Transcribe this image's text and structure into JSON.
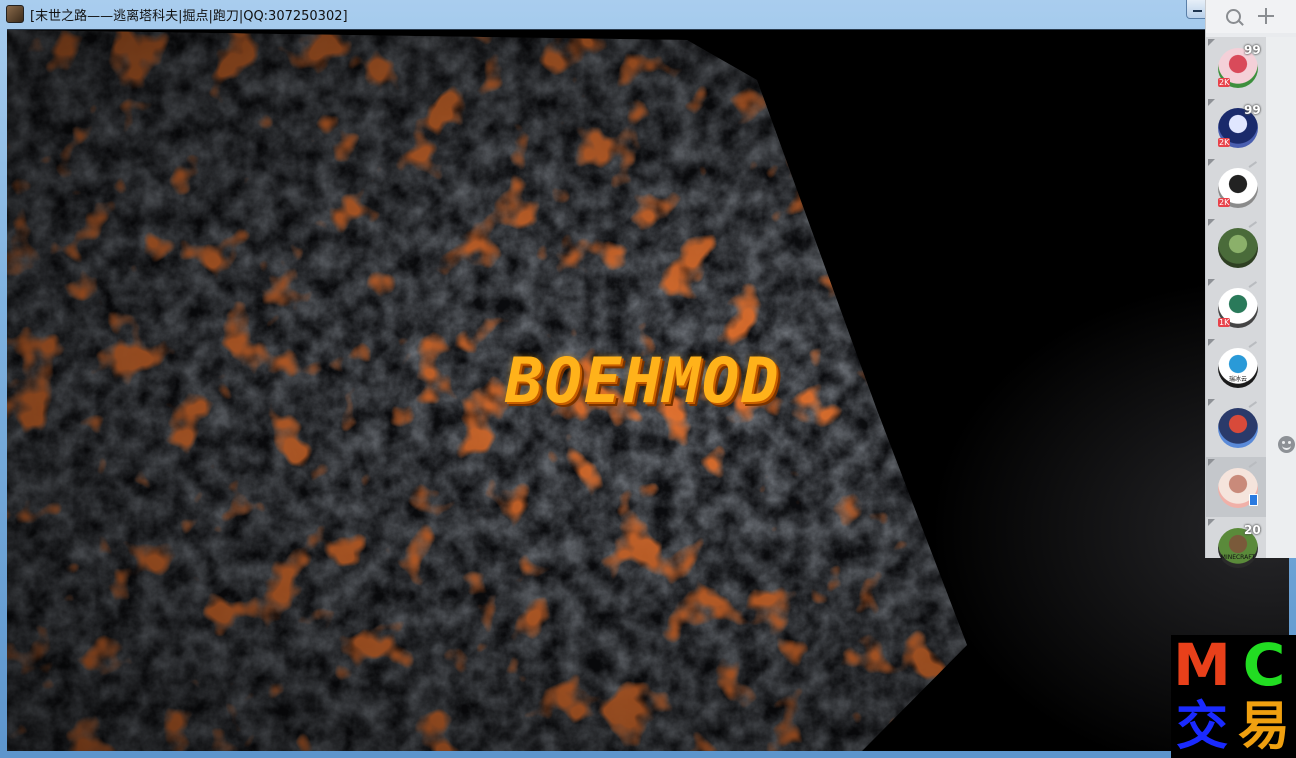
{
  "window": {
    "title": "[末世之路——逃离塔科夫|掘点|跑刀|QQ:307250302]"
  },
  "game": {
    "logo_text": "BOEHMOD"
  },
  "qq_panel": {
    "contacts": [
      {
        "unread": "99",
        "level": "2K",
        "avatar_colors": [
          "#f4d0d8",
          "#d94a5a",
          "#3d8f3d"
        ]
      },
      {
        "unread": "99",
        "level": "2K",
        "avatar_colors": [
          "#1a2a6b",
          "#e0e6ff",
          "#4a5fb0"
        ]
      },
      {
        "unread": "",
        "level": "2K",
        "avatar_colors": [
          "#ffffff",
          "#222222",
          "#8a8a8a"
        ]
      },
      {
        "unread": "",
        "level": "",
        "avatar_colors": [
          "#4a6b3a",
          "#8bb06a",
          "#2e3f22"
        ]
      },
      {
        "unread": "",
        "level": "1K",
        "avatar_colors": [
          "#ffffff",
          "#2a7a5a",
          "#444444"
        ]
      },
      {
        "unread": "",
        "level": "",
        "avatar_colors": [
          "#ffffff",
          "#2a9ad8",
          "#1a1a1a"
        ],
        "avatar_caption": "瑞冰云"
      },
      {
        "unread": "",
        "level": "",
        "avatar_colors": [
          "#2a3a6a",
          "#d84a3a",
          "#5a8ad8"
        ]
      },
      {
        "unread": "",
        "level": "",
        "avatar_colors": [
          "#f5e4dc",
          "#c98a7a",
          "#f0b0a8"
        ]
      },
      {
        "unread": "20",
        "level": "",
        "avatar_colors": [
          "#5a8a3a",
          "#7a5a3a",
          "#2a2a2a"
        ],
        "avatar_caption": "MINECRAFT"
      }
    ]
  },
  "watermark": {
    "chars": [
      {
        "text": "M",
        "color": "#e8401a"
      },
      {
        "text": "C",
        "color": "#22dd22"
      },
      {
        "text": "交",
        "color": "#1a2aff"
      },
      {
        "text": "易",
        "color": "#f0a010"
      }
    ]
  }
}
